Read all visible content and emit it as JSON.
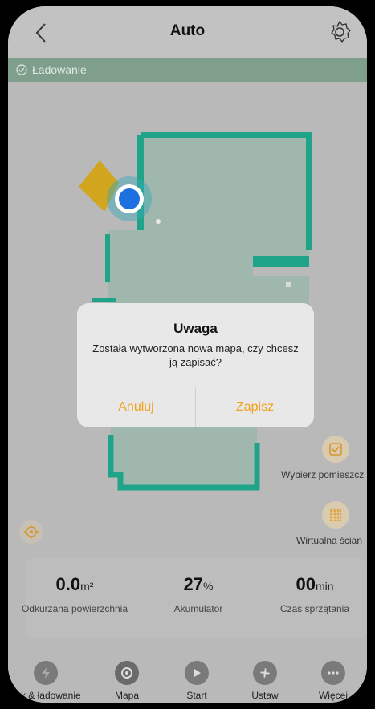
{
  "header": {
    "title": "Auto",
    "back_icon": "chevron-left-icon",
    "settings_icon": "gear-icon"
  },
  "status": {
    "icon": "check-circle-icon",
    "text": "Ładowanie"
  },
  "side_actions": [
    {
      "label": "Wybierz pomieszcz",
      "icon": "checkbox-icon"
    },
    {
      "label": "Wirtualna ścian",
      "icon": "wall-pattern-icon"
    }
  ],
  "stats": [
    {
      "value": "0.0",
      "unit": "m²",
      "label": "Odkurzana powierzchnia"
    },
    {
      "value": "27",
      "unit": "%",
      "label": "Akumulator"
    },
    {
      "value": "00",
      "unit": "min",
      "label": "Czas sprzątania"
    }
  ],
  "bottom_nav": [
    {
      "label": "ock & ładowanie",
      "icon": "lightning-icon"
    },
    {
      "label": "Mapa",
      "icon": "map-pin-icon"
    },
    {
      "label": "Start",
      "icon": "play-icon"
    },
    {
      "label": "Ustaw",
      "icon": "fan-icon"
    },
    {
      "label": "Więcej",
      "icon": "more-icon"
    }
  ],
  "dialog": {
    "title": "Uwaga",
    "message": "Została wytworzona nowa mapa, czy chcesz ją zapisać?",
    "cancel": "Anuluj",
    "confirm": "Zapisz"
  },
  "colors": {
    "accent": "#f0a21a",
    "map_wall": "#1fa489",
    "map_floor": "#9fb7ac",
    "robot": "#1e6fe0"
  }
}
